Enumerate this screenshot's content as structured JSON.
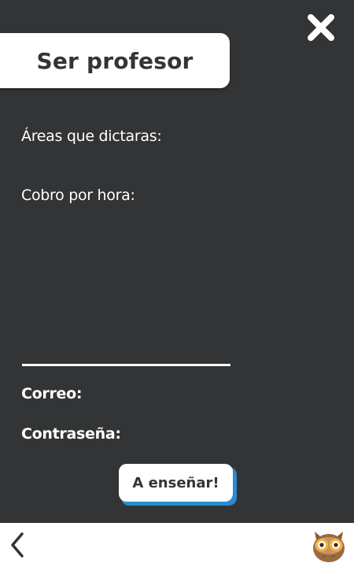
{
  "title": "Ser profesor",
  "form": {
    "areas_label": "Áreas que dictaras:",
    "rate_label": "Cobro por hora:",
    "email_label": "Correo:",
    "password_label": "Contraseña:"
  },
  "actions": {
    "submit_label": "A enseñar!"
  },
  "icons": {
    "close": "close-icon",
    "back": "chevron-left-icon",
    "logo": "owl-logo"
  },
  "colors": {
    "background": "#333435",
    "accent": "#2a8bd1",
    "surface": "#ffffff"
  }
}
